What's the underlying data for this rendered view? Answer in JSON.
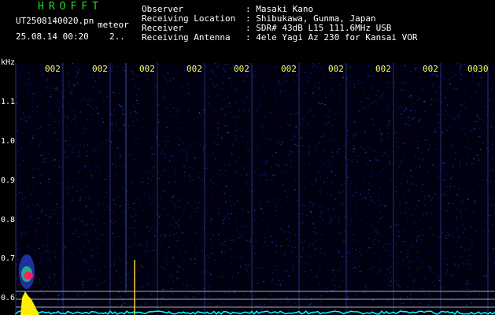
{
  "app": {
    "title": "HROFFT"
  },
  "file": {
    "name": "UT2508140020.pn",
    "mode": "meteor",
    "datetime": "25.08.14 00:20",
    "count": "2.."
  },
  "info": {
    "observer_label": "Observer",
    "observer_value": ": Masaki Kano",
    "location_label": "Receiving Location",
    "location_value": ": Shibukawa, Gunma, Japan",
    "receiver_label": "Receiver",
    "receiver_value": ": SDR# 43dB L15 111.6MHz USB",
    "antenna_label": "Receiving Antenna",
    "antenna_value": ": 4ele Yagi Az 230 for Kansai VOR"
  },
  "axis": {
    "unit": "kHz",
    "y_ticks": [
      "1.1",
      "1.0",
      "0.9",
      "0.8",
      "0.7",
      "0.6"
    ],
    "x_ticks": [
      "002",
      "002",
      "002",
      "002",
      "002",
      "002",
      "002",
      "002",
      "002",
      "0030"
    ]
  },
  "colors": {
    "background": "#000000",
    "noise": "#1a2a9a",
    "trace": "#00ffff",
    "echo_core": "#ff2060",
    "echo_base": "#ffee00",
    "text": "#ffffff",
    "title": "#22dd22",
    "xtick": "#ffff66"
  }
}
